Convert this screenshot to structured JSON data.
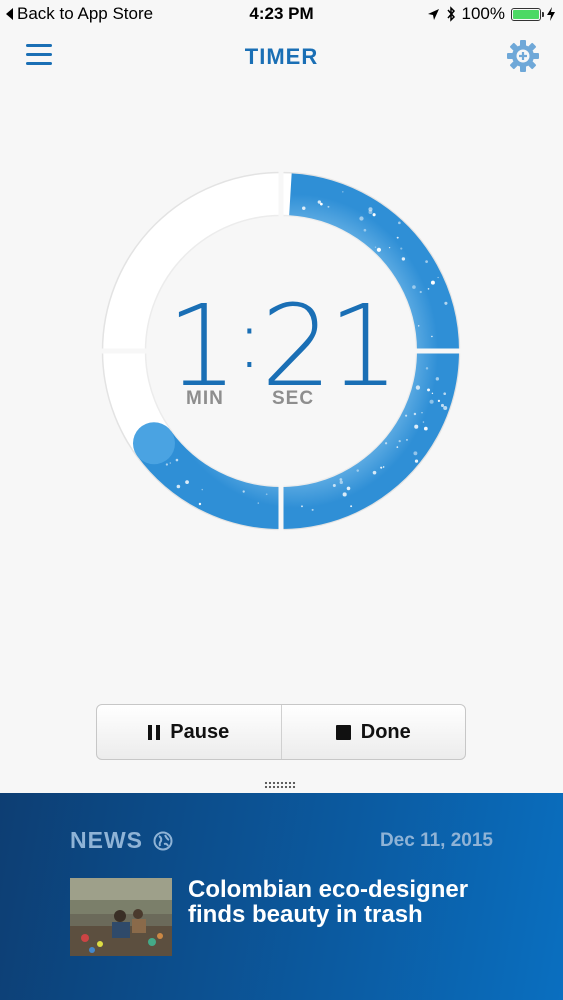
{
  "status_bar": {
    "back_label": "Back to App Store",
    "time": "4:23 PM",
    "battery_percent": "100%",
    "battery_level": 1.0
  },
  "nav": {
    "title": "TIMER",
    "menu_icon": "hamburger-menu-icon",
    "settings_icon": "gear-plus-icon"
  },
  "timer": {
    "minutes": "1",
    "seconds": "21",
    "min_label": "MIN",
    "sec_label": "SEC",
    "progress_remaining_fraction": 0.65,
    "accent_color": "#1a6fb5"
  },
  "controls": {
    "pause_label": "Pause",
    "done_label": "Done"
  },
  "news": {
    "label": "NEWS",
    "date": "Dec 11, 2015",
    "headline": "Colombian eco-designer finds beauty in trash",
    "icon": "globe-icon"
  }
}
